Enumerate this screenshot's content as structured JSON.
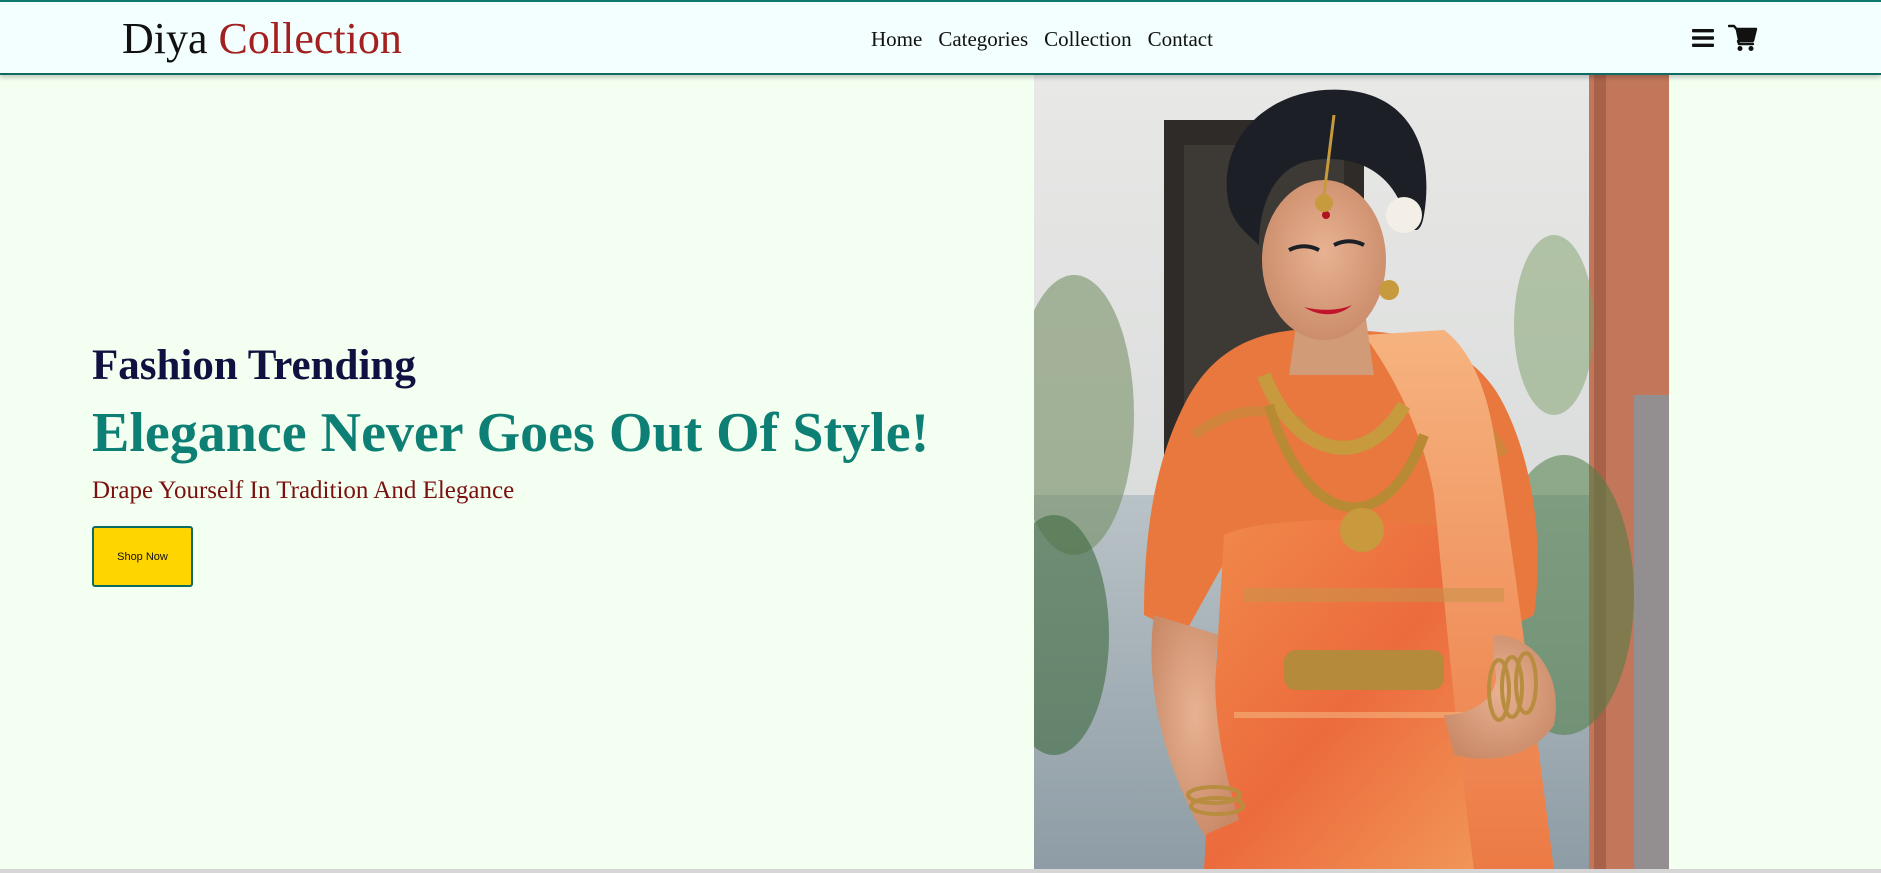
{
  "header": {
    "logo": {
      "part1": "Diya",
      "part2": "Collection"
    },
    "nav": [
      "Home",
      "Categories",
      "Collection",
      "Contact"
    ],
    "icons": [
      "menu-icon",
      "cart-icon"
    ]
  },
  "hero": {
    "subtitle": "Fashion Trending",
    "headline": "Elegance Never Goes Out Of Style!",
    "tagline": "Drape Yourself In Tradition And Elegance",
    "cta_label": "Shop Now"
  },
  "colors": {
    "background": "#f3fff0",
    "header_bg": "#f2fffe",
    "header_border": "#0e7a6e",
    "logo_accent": "#a32020",
    "subtitle": "#0f1240",
    "headline": "#0e7f74",
    "tagline": "#7a1010",
    "button_bg": "#ffd500",
    "button_border": "#0e6b62"
  }
}
